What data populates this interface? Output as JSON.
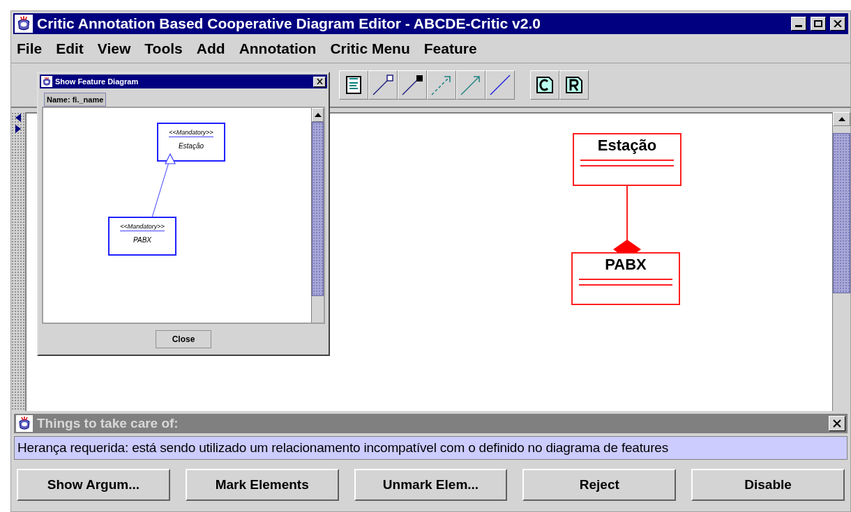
{
  "window": {
    "title": "Critic Annotation Based Cooperative Diagram Editor - ABCDE-Critic v2.0"
  },
  "menu": [
    "File",
    "Edit",
    "View",
    "Tools",
    "Add",
    "Annotation",
    "Critic Menu",
    "Feature"
  ],
  "diagram": {
    "classes": [
      {
        "name": "Estação"
      },
      {
        "name": "PABX"
      }
    ]
  },
  "feature_dialog": {
    "title": "Show Feature Diagram",
    "tab": "Name: fi._name",
    "features": [
      {
        "stereotype": "<<Mandatory>>",
        "name": "Estação"
      },
      {
        "stereotype": "<<Mandatory>>",
        "name": "PABX"
      }
    ],
    "close_button": "Close"
  },
  "critic_panel": {
    "title": "Things to take care of:",
    "message": "Herança requerida: está sendo utilizado um relacionamento incompatível com o definido no diagrama de features",
    "buttons": [
      "Show Argum...",
      "Mark Elements",
      "Unmark Elem...",
      "Reject",
      "Disable"
    ]
  }
}
